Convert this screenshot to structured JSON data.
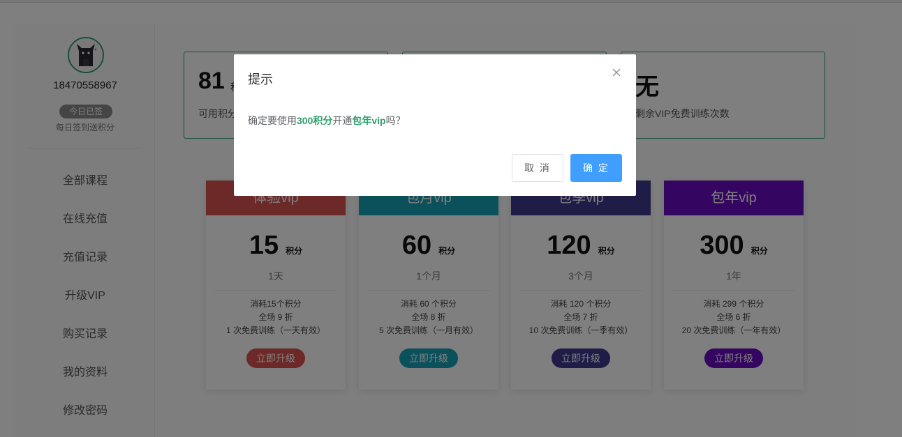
{
  "user": {
    "phone": "18470558967",
    "signin_status": "今日已签",
    "signin_note": "每日签到送积分"
  },
  "sidebar": {
    "items": [
      {
        "label": "全部课程"
      },
      {
        "label": "在线充值"
      },
      {
        "label": "充值记录"
      },
      {
        "label": "升级VIP"
      },
      {
        "label": "购买记录"
      },
      {
        "label": "我的资料"
      },
      {
        "label": "修改密码"
      }
    ]
  },
  "stats": [
    {
      "value": "81",
      "unit": "积分",
      "desc": "可用积分"
    },
    {
      "value": "",
      "unit": "",
      "desc": ""
    },
    {
      "value": "无",
      "unit": "",
      "desc": "剩余VIP免费训练次数"
    }
  ],
  "plans": [
    {
      "name": "体验vip",
      "price": "15",
      "unit": "积分",
      "duration": "1天",
      "features": [
        "消耗15个积分",
        "全场 9 折",
        "1 次免费训练（一天有效）"
      ],
      "button": "立即升级",
      "color": "#d9534f"
    },
    {
      "name": "包月vip",
      "price": "60",
      "unit": "积分",
      "duration": "1个月",
      "features": [
        "消耗 60 个积分",
        "全场 8 折",
        "5 次免费训练（一月有效）"
      ],
      "button": "立即升级",
      "color": "#17a2b8"
    },
    {
      "name": "包季vip",
      "price": "120",
      "unit": "积分",
      "duration": "3个月",
      "features": [
        "消耗 120 个积分",
        "全场 7 折",
        "10 次免费训练（一季有效）"
      ],
      "button": "立即升级",
      "color": "#3f3a8f"
    },
    {
      "name": "包年vip",
      "price": "300",
      "unit": "积分",
      "duration": "1年",
      "features": [
        "消耗 299 个积分",
        "全场 6 折",
        "20 次免费训练（一年有效）"
      ],
      "button": "立即升级",
      "color": "#6a0dc2"
    }
  ],
  "dialog": {
    "title": "提示",
    "msg_prefix": "确定要使用",
    "msg_points": "300积分",
    "msg_middle": "开通",
    "msg_plan": "包年vip",
    "msg_suffix": "吗？",
    "cancel": "取 消",
    "confirm": "确 定"
  },
  "colors": {
    "accent": "#2f9e6e",
    "primary": "#409eff"
  }
}
